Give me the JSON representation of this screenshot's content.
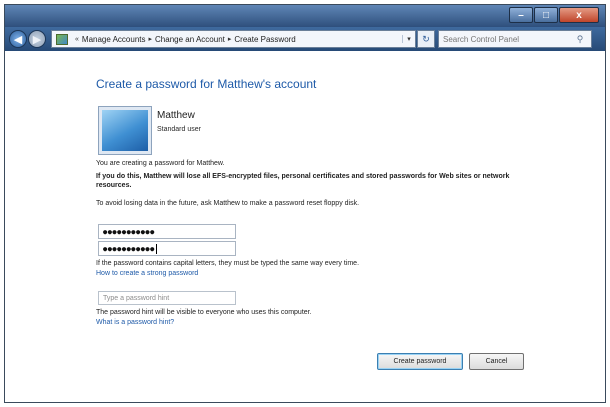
{
  "window": {
    "caption_minimize": "–",
    "caption_maximize": "□",
    "caption_close": "x"
  },
  "navigation": {
    "back_icon": "back-arrow-icon",
    "forward_icon": "forward-arrow-icon",
    "breadcrumb": [
      "Manage Accounts",
      "Change an Account",
      "Create Password"
    ],
    "breadcrumb_lead": "«",
    "breadcrumb_separator": "▸",
    "dropdown_arrow": "▾",
    "refresh_glyph": "↻",
    "search_placeholder": "Search Control Panel",
    "search_glyph": "⚲"
  },
  "page": {
    "title": "Create a password for Matthew's account",
    "user": {
      "name": "Matthew",
      "type": "Standard user"
    },
    "creating_text": "You are creating a password for Matthew.",
    "warning_text": "If you do this, Matthew will lose all EFS-encrypted files, personal certificates and stored passwords for Web sites or network resources.",
    "tip_text": "To avoid losing data in the future, ask Matthew to make a password reset floppy disk.",
    "password_value": "●●●●●●●●●●●",
    "confirm_value": "●●●●●●●●●●●",
    "capital_text": "If the password contains capital letters, they must be typed the same way every time.",
    "strong_link": "How to create a strong password",
    "hint_placeholder": "Type a password hint",
    "hint_visible_text": "The password hint will be visible to everyone who uses this computer.",
    "hint_link": "What is a password hint?"
  },
  "buttons": {
    "create": "Create password",
    "cancel": "Cancel"
  },
  "colors": {
    "link": "#1e5aa8",
    "title": "#1e5aa8"
  }
}
